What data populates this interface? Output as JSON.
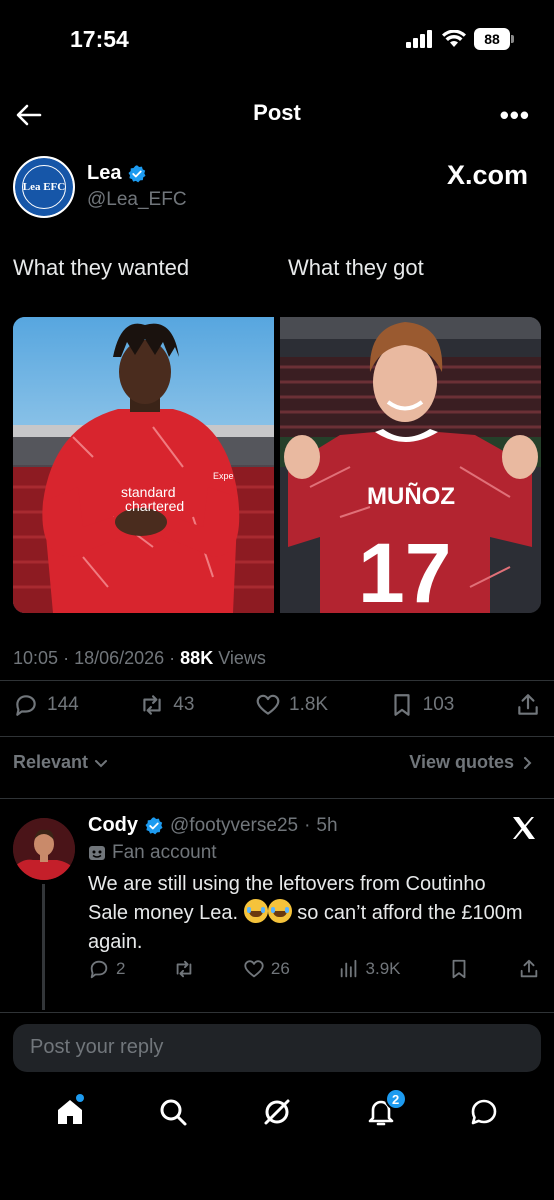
{
  "status_bar": {
    "time": "17:54",
    "battery": "88"
  },
  "header": {
    "title": "Post",
    "more": "•••"
  },
  "author": {
    "name": "Lea",
    "handle": "@Lea_EFC",
    "avatar_text": "Lea EFC",
    "source": "X.com"
  },
  "post": {
    "caption_left": "What they wanted",
    "caption_right": "What they got",
    "image_right_jersey_name": "MUÑOZ",
    "image_right_jersey_number": "17",
    "image_left_sponsor": "standard chartered",
    "time": "10:05",
    "date": "18/06/2026",
    "views_count": "88K",
    "views_label": "Views"
  },
  "actions": {
    "replies": "144",
    "reposts": "43",
    "likes": "1.8K",
    "bookmarks": "103"
  },
  "sort": {
    "relevant": "Relevant",
    "view_quotes": "View quotes"
  },
  "reply": {
    "name": "Cody",
    "handle": "@footyverse25",
    "time": "5h",
    "badge": "Fan account",
    "text_1": "We are still using the leftovers from Coutinho Sale money Lea.",
    "text_2": "so can’t afford the £100m again.",
    "replies": "2",
    "likes": "26",
    "views": "3.9K"
  },
  "reply_input": {
    "placeholder": "Post your reply"
  },
  "nav": {
    "notifications_count": "2"
  },
  "colors": {
    "accent": "#1d9bf0",
    "background": "#000000",
    "muted": "#71767b"
  }
}
